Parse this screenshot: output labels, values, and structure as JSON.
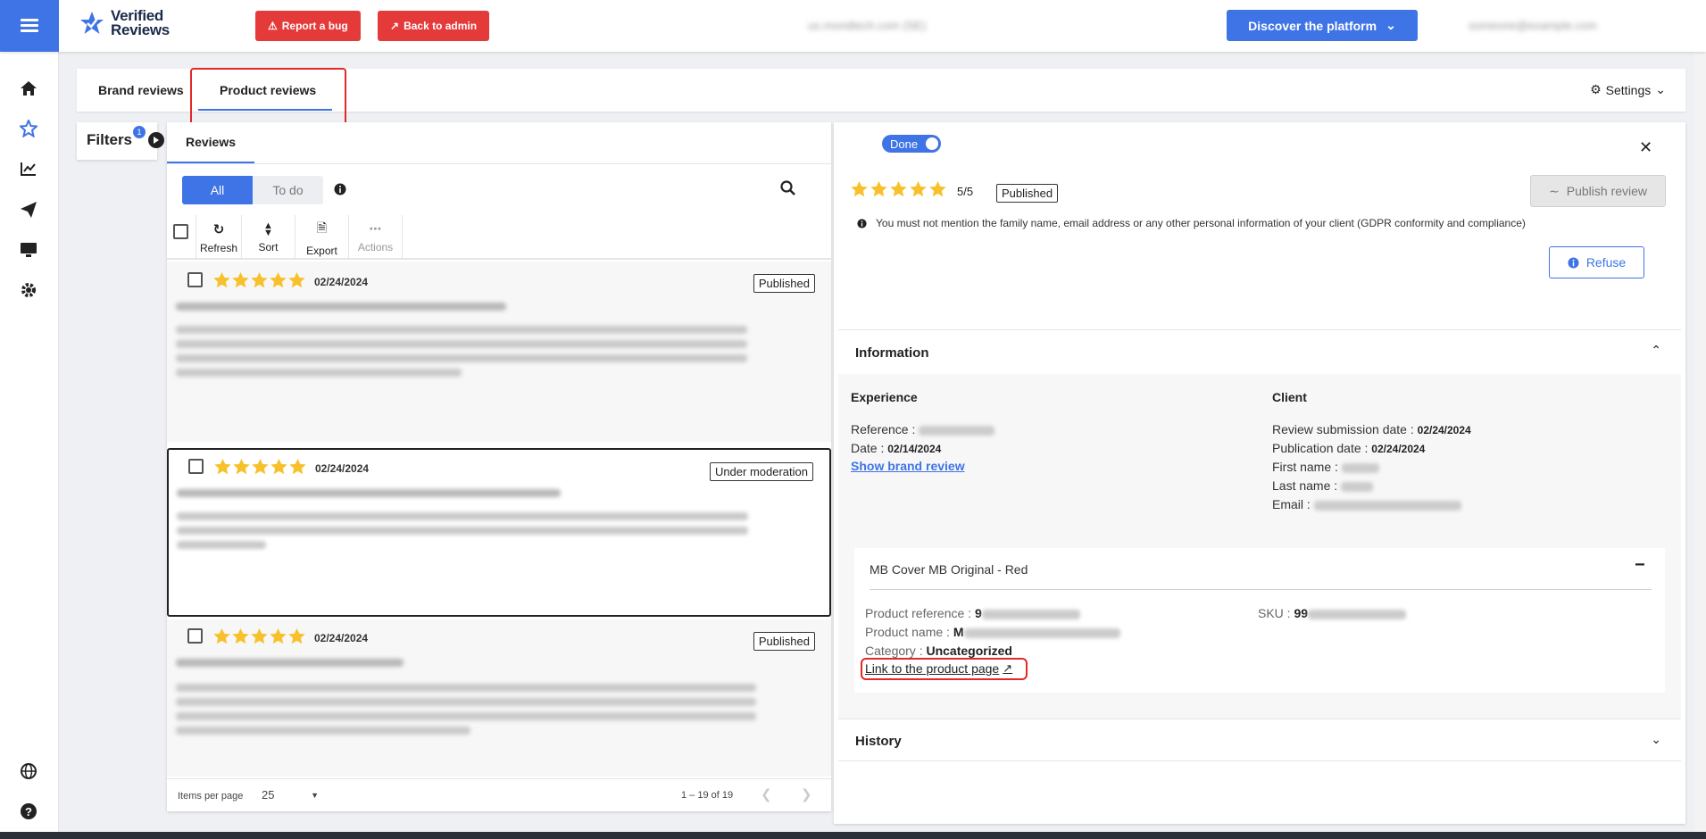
{
  "app": {
    "logo_line1": "Verified",
    "logo_line2": "Reviews",
    "report_bug": "Report a bug",
    "back_admin": "Back to admin",
    "discover": "Discover the platform",
    "blurred_domain": "us.mondtech.com (SE)",
    "blurred_user": "someone@example.com",
    "brand_color": "#3f74e6",
    "danger_color": "#e53a3a"
  },
  "sidebar": {
    "icons": [
      "home-icon",
      "star-icon",
      "chart-icon",
      "paper-plane-icon",
      "monitor-icon",
      "gear-icon",
      "globe-icon",
      "help-icon"
    ]
  },
  "tabs": {
    "brand": "Brand reviews",
    "product": "Product reviews",
    "settings": "Settings"
  },
  "filters": {
    "label": "Filters",
    "count": "1"
  },
  "list": {
    "tab": "Reviews",
    "seg_all": "All",
    "seg_todo": "To do",
    "tools": {
      "refresh": "Refresh",
      "sort": "Sort",
      "export": "Export",
      "actions": "Actions"
    },
    "reviews": [
      {
        "date": "02/24/2024",
        "status": "Published"
      },
      {
        "date": "02/24/2024",
        "status": "Under moderation"
      },
      {
        "date": "02/24/2024",
        "status": "Published"
      }
    ],
    "footer": {
      "items_per_page": "Items per page",
      "per_page_value": "25",
      "range": "1 – 19 of 19"
    }
  },
  "detail": {
    "toggle": "Done",
    "rating": "5/5",
    "status": "Published",
    "publish_btn": "Publish review",
    "notice": "You must not mention the family name, email address or any other personal information of your client (GDPR conformity and compliance)",
    "refuse_btn": "Refuse",
    "information": "Information",
    "experience": {
      "title": "Experience",
      "reference_label": "Reference :",
      "date_label": "Date :",
      "date_value": "02/14/2024",
      "show_brand": "Show brand review"
    },
    "client": {
      "title": "Client",
      "submission_label": "Review submission date :",
      "submission_value": "02/24/2024",
      "publication_label": "Publication date :",
      "publication_value": "02/24/2024",
      "first_name_label": "First name :",
      "last_name_label": "Last name :",
      "email_label": "Email :"
    },
    "product": {
      "title": "MB Cover MB Original - Red",
      "ref_label": "Product reference :",
      "ref_value": "9",
      "sku_label": "SKU :",
      "sku_value": "99",
      "name_label": "Product name :",
      "name_value": "M",
      "category_label": "Category :",
      "category_value": "Uncategorized",
      "link": "Link to the product page"
    },
    "history": "History"
  }
}
